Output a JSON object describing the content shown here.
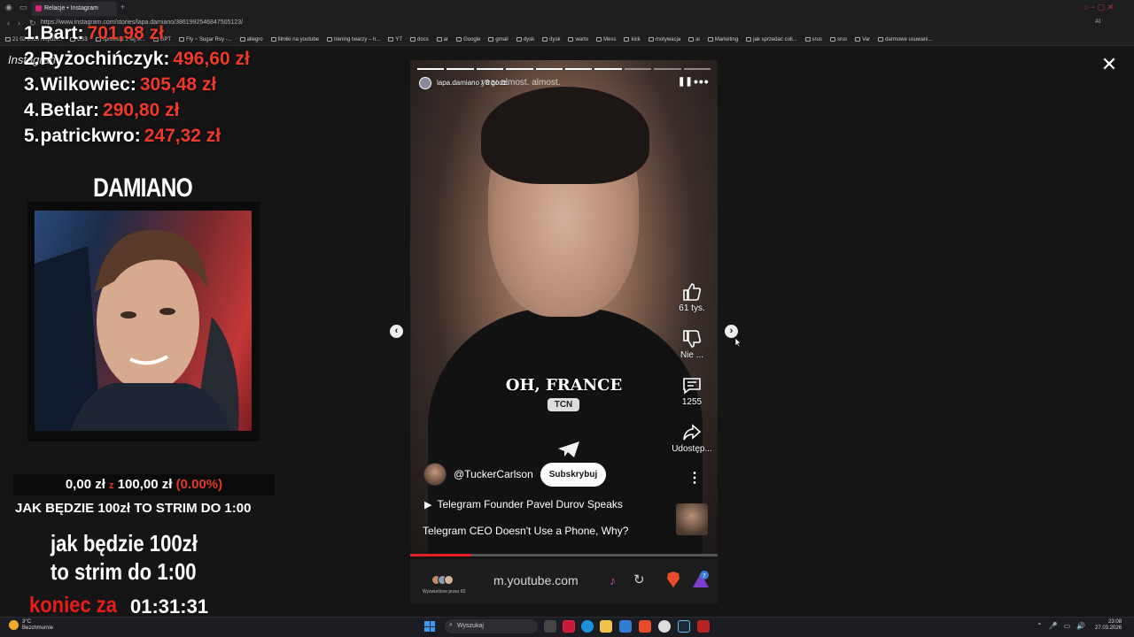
{
  "browser": {
    "tab_title": "Relacje • Instagram",
    "url": "https://www.instagram.com/stories/lapa.damiano/3861992546847505123/",
    "bookmarks": [
      "21 02 2026 niepubl...",
      "CS3",
      "sprzedaż z tej sł...",
      "GPT",
      "Fly ~ Sugar Rsy -...",
      "allegro",
      "filmiki na youtube",
      "trening twarzy – h...",
      "YT",
      "docs",
      "ar",
      "Google",
      "gmail",
      "dysk",
      "dysk",
      "warto",
      "Mess",
      "kick",
      "motywacja",
      "ai",
      "Marketing",
      "jak sprzedać coli...",
      "srus",
      "srus",
      "Var",
      "darmowe usuwani..."
    ],
    "ai_label": "AI"
  },
  "overlay": {
    "instagram_label": "Instagram",
    "leaderboard": [
      {
        "rank": "1.",
        "name": "Bart:",
        "amount": "701,98 zł"
      },
      {
        "rank": "2.",
        "name": "Ryżochińczyk:",
        "amount": "496,60 zł"
      },
      {
        "rank": "3.",
        "name": "Wilkowiec:",
        "amount": "305,48 zł"
      },
      {
        "rank": "4.",
        "name": "Betlar:",
        "amount": "290,80 zł"
      },
      {
        "rank": "5.",
        "name": "patrickwro:",
        "amount": "247,32 zł"
      }
    ],
    "streamer_name": "DAMIANO",
    "goal": {
      "current": "0,00 zł",
      "sep": "z",
      "target": "100,00 zł",
      "percent": "(0.00%)",
      "progress": 0
    },
    "goal_caption": "JAK BĘDZIE 100zł TO STRIM DO 1:00",
    "goal_big_line1": "jak będzie 100zł",
    "goal_big_line2": "to strim do 1:00",
    "end_label": "koniec za",
    "end_time": "01:31:31"
  },
  "story": {
    "author": "lapa.damiano / 8 godz.",
    "caption_top": "year almost. almost.",
    "subtitle": "OH, FRANCE",
    "tcn": "TCN",
    "likes": "61 tys.",
    "dislike": "Nie ...",
    "comments": "1255",
    "share": "Udostęp...",
    "channel": "@TuckerCarlson",
    "subscribe": "Subskrybuj",
    "video_title": "Telegram Founder Pavel Durov Speaks",
    "video_desc": "Telegram CEO Doesn't Use a Phone, Why?",
    "progress_segments": 10,
    "segments_done": 7,
    "video_progress": 0.2,
    "mobile_url": "m.youtube.com",
    "viewers_label": "Wyświetlone przez 82"
  },
  "taskbar": {
    "weather_temp": "3°C",
    "weather_desc": "Bezchmurnie",
    "search_placeholder": "Wyszukaj",
    "time": "23:08",
    "date": "27.03.2026"
  },
  "colors": {
    "accent_red": "#ef3a2a",
    "youtube_red": "#e61f2a"
  }
}
